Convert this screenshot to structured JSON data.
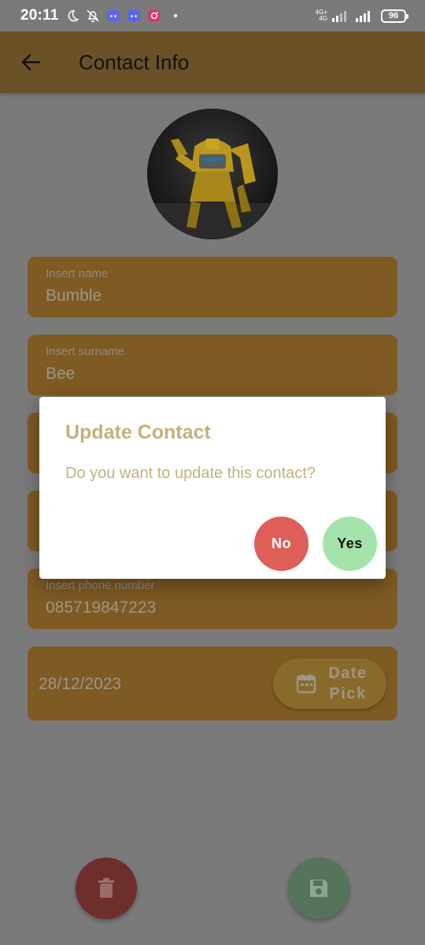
{
  "status_bar": {
    "time": "20:11",
    "network_top": "4G+",
    "network_bottom": "4G",
    "battery": "96"
  },
  "app_bar": {
    "title": "Contact Info"
  },
  "form": {
    "name": {
      "label": "Insert name",
      "value": "Bumble"
    },
    "surname": {
      "label": "Insert surname",
      "value": "Bee"
    },
    "phone": {
      "label": "Insert phone number",
      "value": "085719847223"
    },
    "date": {
      "value": "28/12/2023",
      "button_label": "Date Pick"
    }
  },
  "dialog": {
    "title": "Update Contact",
    "message": "Do you want to update this contact?",
    "no_label": "No",
    "yes_label": "Yes"
  },
  "colors": {
    "app_bar": "#6b5128",
    "field": "#7f5a23",
    "dialog_text": "#c3b07c",
    "no_button": "#de5e5a",
    "yes_button": "#a5e3ac",
    "delete_fab": "#6e2e2b",
    "save_fab": "#56745a"
  },
  "icons": {
    "back": "arrow-back-icon",
    "calendar": "calendar-icon",
    "delete": "trash-icon",
    "save": "floppy-disk-icon"
  }
}
